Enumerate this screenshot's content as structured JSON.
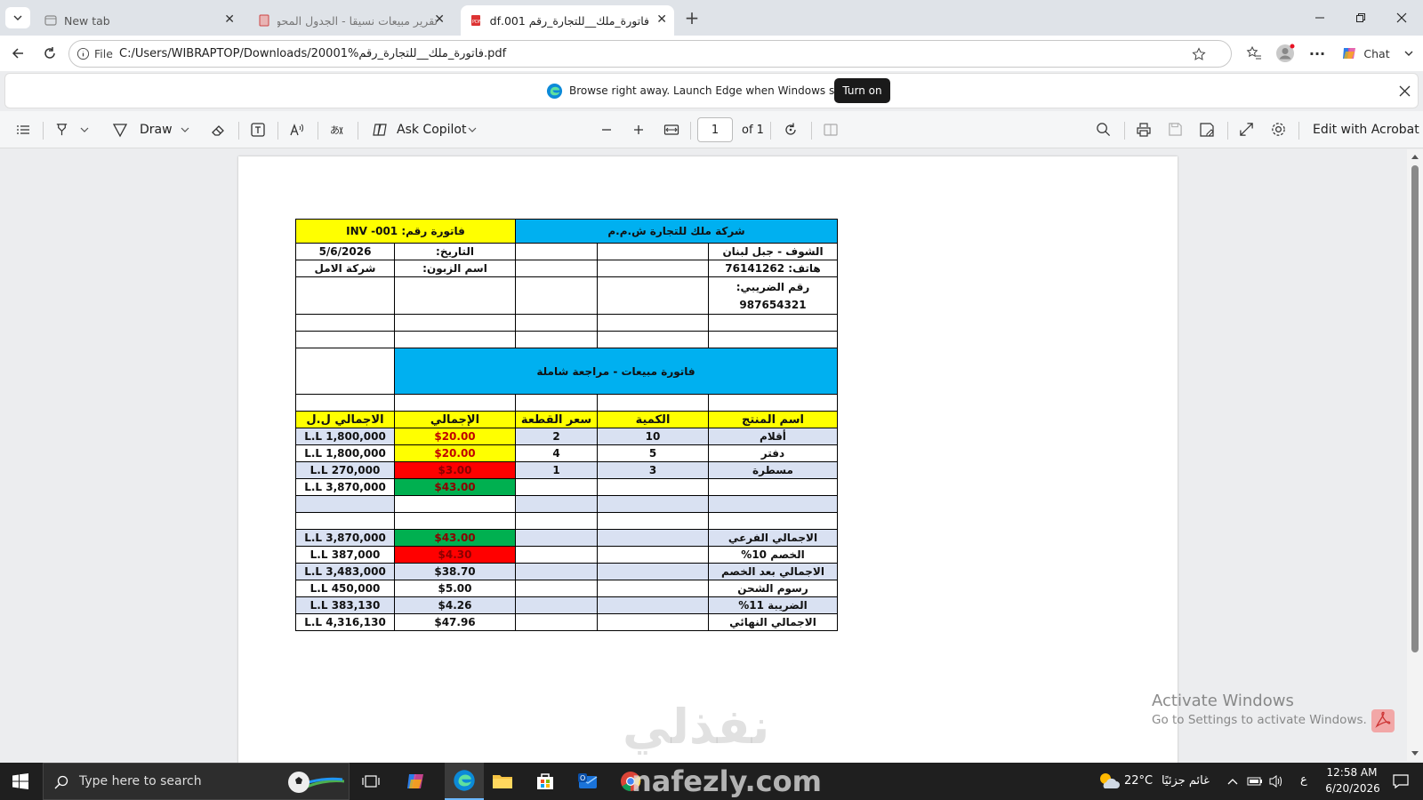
{
  "tabs": [
    {
      "title": "New tab"
    },
    {
      "title": "تقرير مبيعات نسيقا - الجدول المحوري"
    },
    {
      "title": "فاتورة_ملك__للتجارة_رقم 001.pdf"
    }
  ],
  "address": {
    "scheme": "File",
    "url": "C:/Users/WIBRAPTOP/Downloads/20001%فاتورة_ملك__للتجارة_رقم.pdf"
  },
  "chat_label": "Chat",
  "infobar": {
    "message": "Browse right away. Launch Edge when Windows starts.",
    "button": "Turn on"
  },
  "pdf_toolbar": {
    "draw": "Draw",
    "ask_copilot": "Ask Copilot",
    "page_value": "1",
    "page_of": "of 1",
    "edit_acrobat": "Edit with Acrobat"
  },
  "invoice": {
    "company": "شركة ملك للتجارة ش.م.م",
    "invoice_no": "فاتورة رقم: 001- INV",
    "address": "الشوف - جبل لبنان",
    "date_label": "التاريخ:",
    "date": "5/6/2026",
    "phone": "هاتف: 76141262",
    "customer_label": "اسم الزبون:",
    "customer": "شركة الامل",
    "tax_label": "رقم الضريبي:",
    "tax_no": "987654321",
    "title": "فاتورة مبيعات - مراجعة شاملة",
    "headers": [
      "اسم المنتج",
      "الكمية",
      "سعر القطعة",
      "الإجمالي",
      "الاجمالي ل.ل"
    ],
    "items": [
      {
        "name": "أقلام",
        "qty": "10",
        "price": "2",
        "total": "$20.00",
        "lbp": "1,800,000 L.L"
      },
      {
        "name": "دفتر",
        "qty": "5",
        "price": "4",
        "total": "$20.00",
        "lbp": "1,800,000 L.L"
      },
      {
        "name": "مسطرة",
        "qty": "3",
        "price": "1",
        "total": "$3.00",
        "lbp": "270,000 L.L"
      },
      {
        "name": "",
        "qty": "",
        "price": "",
        "total": "$43.00",
        "lbp": "3,870,000 L.L"
      }
    ],
    "summary": [
      {
        "label": "الاجمالي الفرعي",
        "usd": "$43.00",
        "lbp": "3,870,000 L.L"
      },
      {
        "label": "الخصم 10%",
        "usd": "$4.30",
        "lbp": "387,000 L.L"
      },
      {
        "label": "الاجمالي بعد الخصم",
        "usd": "$38.70",
        "lbp": "3,483,000 L.L"
      },
      {
        "label": "رسوم الشحن",
        "usd": "$5.00",
        "lbp": "450,000 L.L"
      },
      {
        "label": "الضريبة 11%",
        "usd": "$4.26",
        "lbp": "383,130 L.L"
      },
      {
        "label": "الاجمالي النهائي",
        "usd": "$47.96",
        "lbp": "4,316,130 L.L"
      }
    ]
  },
  "watermark": {
    "arabic": "نفذلي",
    "latin": "nafezly.com"
  },
  "activate": {
    "title": "Activate Windows",
    "subtitle": "Go to Settings to activate Windows."
  },
  "taskbar": {
    "search": "Type here to search",
    "weather": "22°C",
    "weather_text": "غائم جزئيًا",
    "lang": "ع",
    "time": "12:58 AM",
    "date": "6/20/2026"
  },
  "colors": {
    "cyan": "#00b0f0",
    "yellow": "#ffff00",
    "red": "#ff0000",
    "green": "#00b050",
    "lavender": "#d9e1f2"
  }
}
